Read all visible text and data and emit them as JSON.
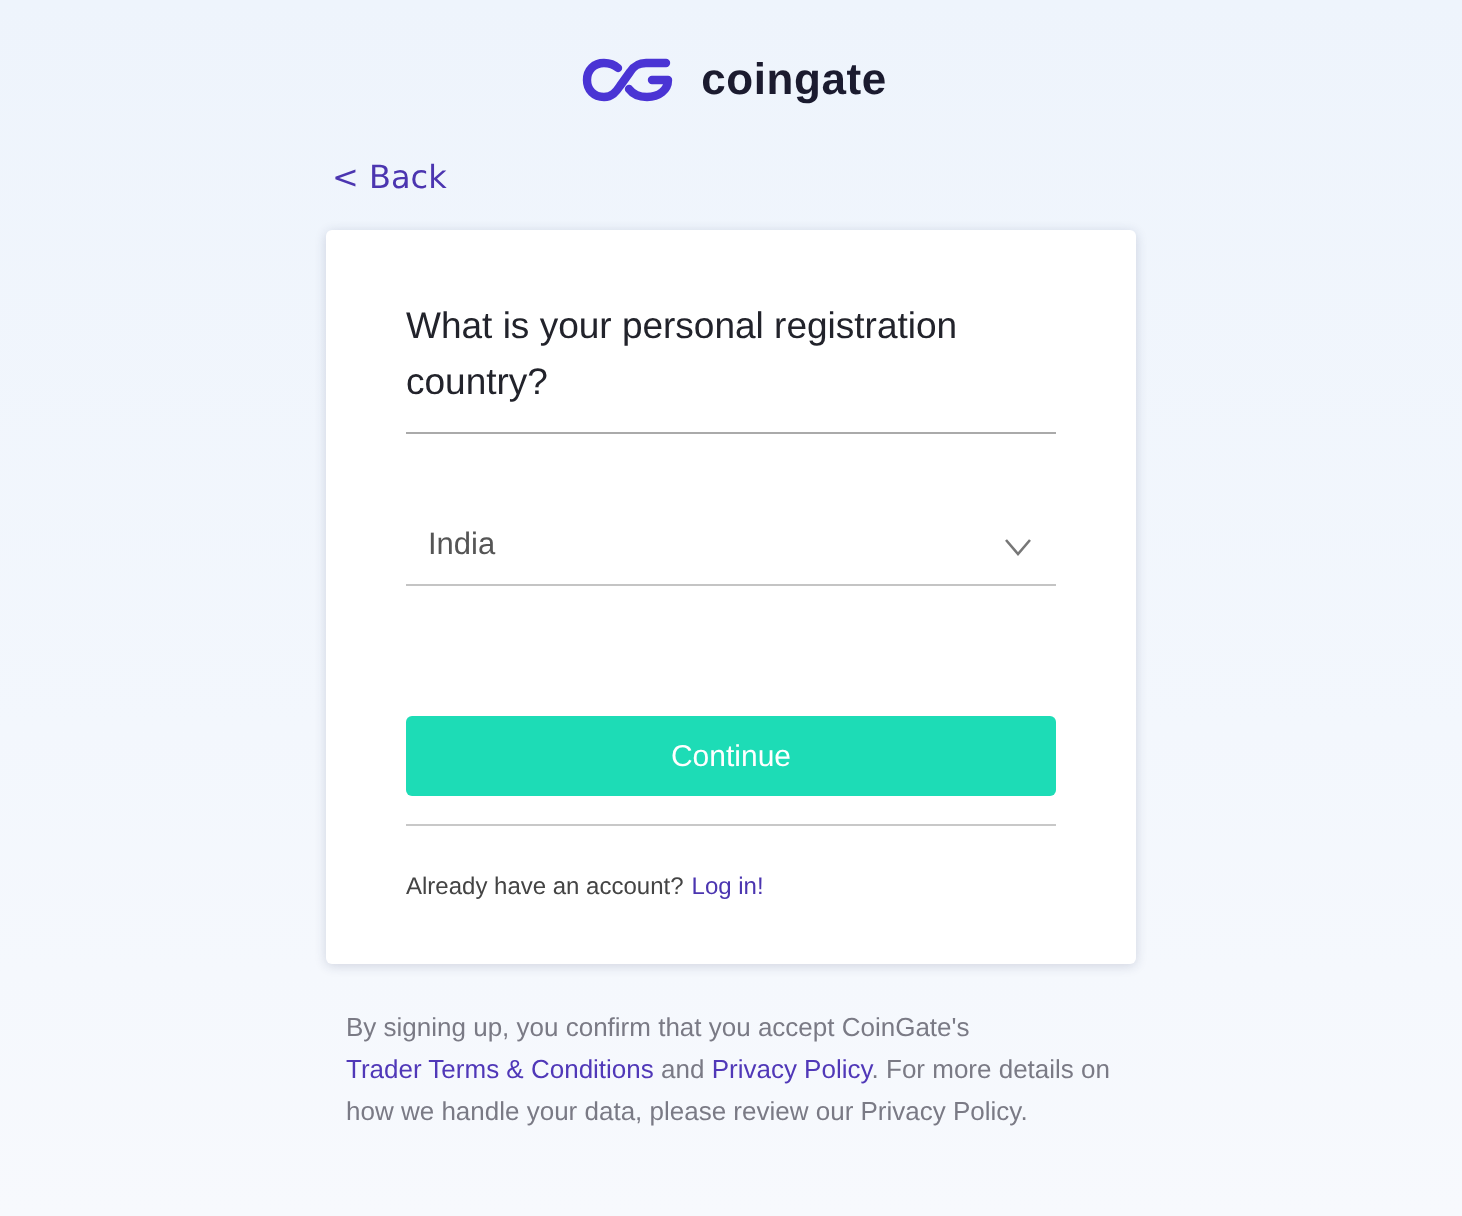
{
  "brand": {
    "name": "coingate"
  },
  "back_link": {
    "label": "< Back"
  },
  "form": {
    "question": "What is your personal registration country?",
    "country_select": {
      "value": "India"
    },
    "continue_button": {
      "label": "Continue"
    },
    "login_prompt": {
      "text": "Already have an account?",
      "link": "Log in!"
    }
  },
  "footer_note": [
    {
      "kind": "plain",
      "text": "By signing up, you confirm that you accept CoinGate's "
    },
    {
      "kind": "link",
      "text": "Trader Terms & Conditions"
    },
    {
      "kind": "plain",
      "text": " and "
    },
    {
      "kind": "link",
      "text": "Privacy Policy"
    },
    {
      "kind": "plain",
      "text": ". For more details on how we handle your data, please review our Privacy Policy."
    }
  ]
}
